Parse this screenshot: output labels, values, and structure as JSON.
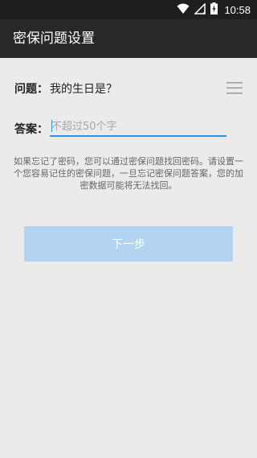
{
  "status_bar": {
    "time": "10:58",
    "icons": [
      "wifi-icon",
      "signal-icon",
      "battery-charging-icon"
    ]
  },
  "app_bar": {
    "title": "密保问题设置"
  },
  "question": {
    "label": "问题：",
    "text": "我的生日是？",
    "menu_icon": "menu-icon"
  },
  "answer": {
    "label": "答案：",
    "value": "",
    "placeholder": "不超过50个字"
  },
  "hint": "如果忘记了密码，您可以通过密保问题找回密码。请设置一个您容易记住的密保问题，一旦忘记密保问题答案，您的加密数据可能将无法找回。",
  "next_button": {
    "label": "下一步",
    "state": "disabled"
  },
  "colors": {
    "status_bar": "#1f1f1f",
    "app_bar": "#282828",
    "background": "#ebebeb",
    "accent": "#2a95e0",
    "button_disabled": "#b2d4f0"
  }
}
